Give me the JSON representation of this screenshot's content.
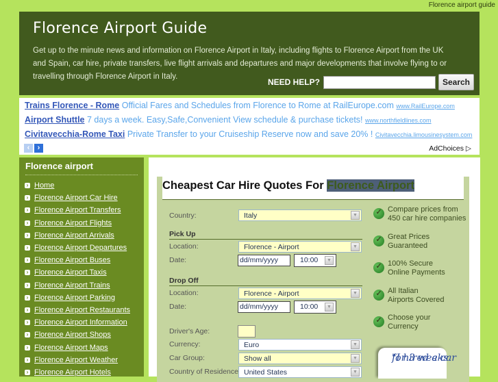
{
  "top_link": "Florence airport guide",
  "header": {
    "title": "Florence Airport Guide",
    "description": "Get up to the minute news and information on Florence Airport in Italy, including flights to Florence Airport from the UK and Spain, car hire, private transfers, live flight arrivals and departures and major developments that involve flying to or travelling through Florence Airport in Italy.",
    "need_help_label": "NEED HELP?",
    "search_value": "",
    "search_button": "Search"
  },
  "ads": {
    "items": [
      {
        "title": "Trains Florence - Rome",
        "text": "Official Fares and Schedules from Florence to Rome at RailEurope.com",
        "url": "www.RailEurope.com"
      },
      {
        "title": "Airport Shuttle",
        "text": "7 days a week. Easy,Safe,Convenient View schedule & purchase tickets!",
        "url": "www.northfieldlines.com"
      },
      {
        "title": "Civitavecchia-Rome Taxi",
        "text": "Private Transfer to your Cruiseship Reserve now and save 20% !",
        "url": "Civitavecchia.limousinesystem.com"
      }
    ],
    "prev_icon": "‹",
    "next_icon": "›",
    "adchoices": "AdChoices ▷"
  },
  "sidebar": {
    "title": "Florence airport",
    "items": [
      "Home",
      "Florence Airport Car Hire",
      "Florence Airport Transfers",
      "Florence Airport Flights",
      "Florence Airport Arrivals",
      "Florence Airport Departures",
      "Florence Airport Buses",
      "Florence Airport Taxis",
      "Florence Airport Trains",
      "Florence Airport Parking",
      "Florence Airport Restaurants",
      "Florence Airport Information",
      "Florence Airport Shops",
      "Florence Airport Maps",
      "Florence Airport Weather",
      "Florence Airport Hotels"
    ]
  },
  "form": {
    "title_prefix": "Cheapest Car Hire Quotes For ",
    "title_highlight": "Florence Airport",
    "country_label": "Country:",
    "country_value": "Italy",
    "pickup_heading": "Pick Up",
    "pickup_location_label": "Location:",
    "pickup_location_value": "Florence - Airport",
    "pickup_date_label": "Date:",
    "pickup_date_value": "dd/mm/yyyy",
    "pickup_time_value": "10:00",
    "dropoff_heading": "Drop Off",
    "dropoff_location_label": "Location:",
    "dropoff_location_value": "Florence - Airport",
    "dropoff_date_label": "Date:",
    "dropoff_date_value": "dd/mm/yyyy",
    "dropoff_time_value": "10:00",
    "age_label": "Driver's Age:",
    "age_value": "",
    "currency_label": "Currency:",
    "currency_value": "Euro",
    "car_group_label": "Car Group:",
    "car_group_value": "Show all",
    "residence_label": "Country of Residence:",
    "residence_value": "United States"
  },
  "features": [
    {
      "line1": "Compare prices from",
      "line2": "450 car hire companies"
    },
    {
      "line1": "Great Prices",
      "line2": "Guaranteed"
    },
    {
      "line1": "100% Secure",
      "line2": "Online Payments"
    },
    {
      "line1": "All Italian",
      "line2": "Airports Covered"
    },
    {
      "line1": "Choose your",
      "line2": "Currency"
    }
  ],
  "testimonial": {
    "line1": "\"I hired a car",
    "line2": "for 3 weeks"
  }
}
